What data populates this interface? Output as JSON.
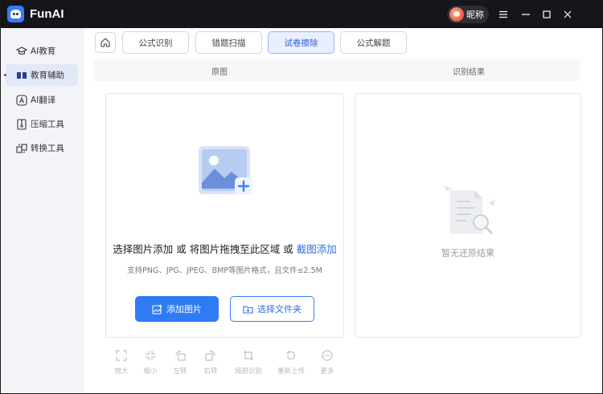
{
  "app": {
    "name": "FunAI"
  },
  "user": {
    "nickname": "昵称"
  },
  "sidebar": {
    "items": [
      {
        "label": "AI教育",
        "icon": "graduation-cap-icon",
        "active": false
      },
      {
        "label": "教育辅助",
        "icon": "book-icon",
        "active": true
      },
      {
        "label": "AI翻译",
        "icon": "translate-icon",
        "active": false
      },
      {
        "label": "压缩工具",
        "icon": "compress-icon",
        "active": false
      },
      {
        "label": "转换工具",
        "icon": "convert-icon",
        "active": false
      }
    ]
  },
  "tabs": [
    {
      "label": "公式识别",
      "active": false
    },
    {
      "label": "错题扫描",
      "active": false
    },
    {
      "label": "试卷擦除",
      "active": true
    },
    {
      "label": "公式解题",
      "active": false
    }
  ],
  "columns": {
    "left": "原图",
    "right": "识别结果"
  },
  "upload": {
    "hint_prefix": "选择图片添加 或 将图片拖拽至此区域 或 ",
    "hint_link": "截图添加",
    "format_hint": "支持PNG、JPG、JPEG、BMP等图片格式，且文件≤2.5M",
    "add_image_label": "添加图片",
    "select_folder_label": "选择文件夹"
  },
  "result": {
    "empty_text": "暂无还原结果"
  },
  "toolbar": {
    "items": [
      {
        "label": "放大",
        "icon": "expand-icon"
      },
      {
        "label": "缩小",
        "icon": "shrink-icon"
      },
      {
        "label": "左转",
        "icon": "rotate-left-icon"
      },
      {
        "label": "右转",
        "icon": "rotate-right-icon"
      },
      {
        "label": "局部识别",
        "icon": "crop-icon"
      },
      {
        "label": "重新上传",
        "icon": "reupload-icon"
      },
      {
        "label": "更多",
        "icon": "more-icon"
      }
    ]
  },
  "colors": {
    "accent": "#2f7bf5",
    "titlebar": "#15161b",
    "active_tab_bg": "#e9efff",
    "sidebar_active_bg": "#e2e8f8"
  }
}
